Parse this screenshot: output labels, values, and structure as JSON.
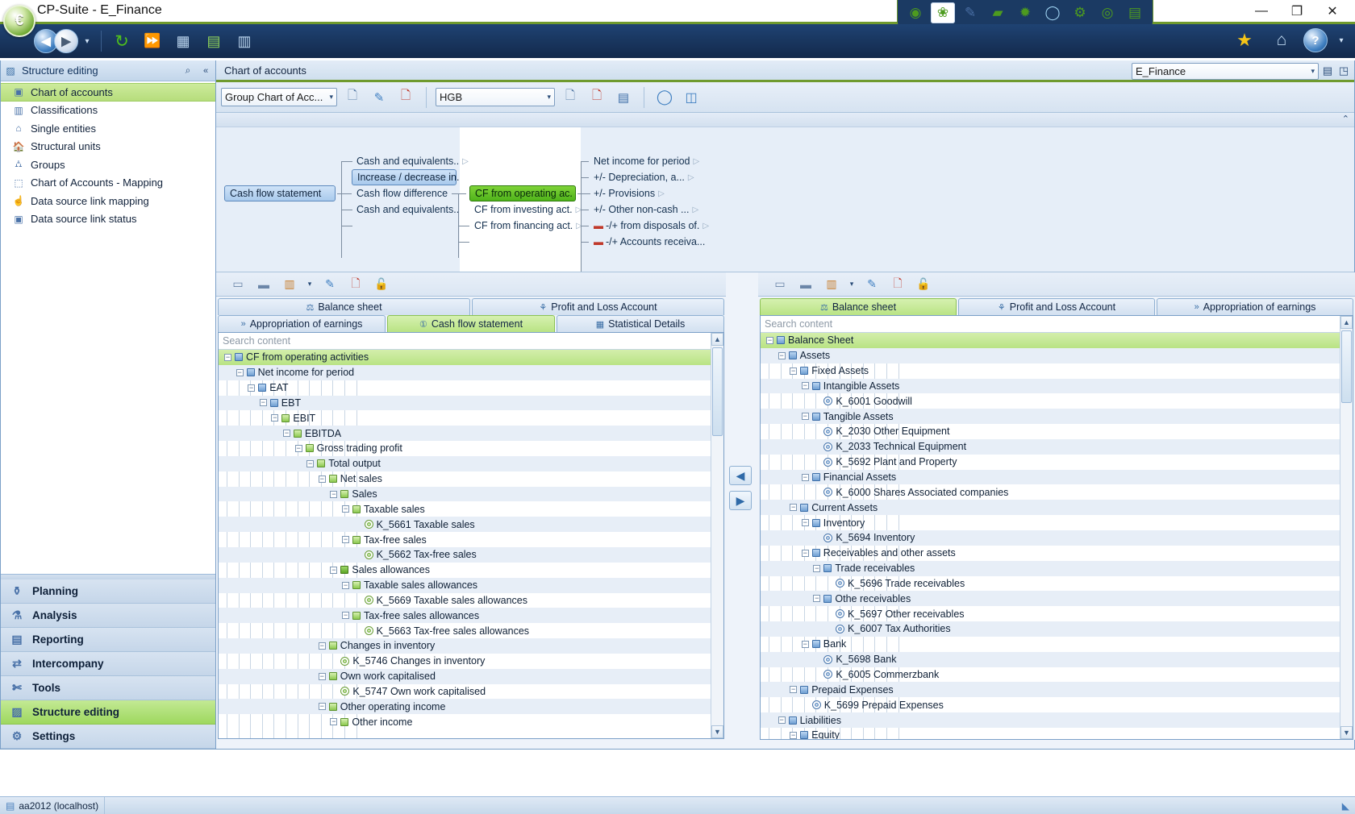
{
  "window": {
    "title": "CP-Suite - E_Finance",
    "app_icon": "euro-orb-icon",
    "minimize": "—",
    "maximize": "❐",
    "close": "✕"
  },
  "quick_access": [
    {
      "name": "dashboard-icon",
      "glyph": "◉"
    },
    {
      "name": "structure-icon",
      "glyph": "❀",
      "active": true
    },
    {
      "name": "planning-icon",
      "glyph": "✎"
    },
    {
      "name": "cash-icon",
      "glyph": "▰"
    },
    {
      "name": "globe-icon",
      "glyph": "🌐"
    },
    {
      "name": "lifering-icon",
      "glyph": "◯"
    },
    {
      "name": "gears-icon",
      "glyph": "⚙"
    },
    {
      "name": "compass-icon",
      "glyph": "◎"
    },
    {
      "name": "user-admin-icon",
      "glyph": "▤"
    }
  ],
  "navbar": {
    "back": "◀",
    "forward": "▶",
    "history_dropdown": "▾",
    "refresh": "↻",
    "fast_forward": "⏩",
    "table_icon": "▦",
    "import_icon": "▤",
    "report_icon": "▥",
    "favorites": "★",
    "home": "⌂",
    "help": "?",
    "help_dropdown": "▾"
  },
  "left_pane": {
    "header": "Structure editing",
    "search_icon": "search-icon",
    "collapse_icon": "«",
    "items": [
      {
        "label": "Chart of accounts",
        "icon": "chart-of-accounts-icon",
        "glyph": "▣",
        "selected": true
      },
      {
        "label": "Classifications",
        "icon": "classifications-icon",
        "glyph": "▥",
        "selected": false
      },
      {
        "label": "Single entities",
        "icon": "single-entities-icon",
        "glyph": "⌂",
        "selected": false
      },
      {
        "label": "Structural units",
        "icon": "structural-units-icon",
        "glyph": "🏠",
        "selected": false
      },
      {
        "label": "Groups",
        "icon": "groups-icon",
        "glyph": "⛼",
        "selected": false
      },
      {
        "label": "Chart of Accounts - Mapping",
        "icon": "mapping-icon",
        "glyph": "⬚",
        "selected": false
      },
      {
        "label": "Data source link mapping",
        "icon": "link-mapping-icon",
        "glyph": "☝",
        "selected": false
      },
      {
        "label": "Data source link status",
        "icon": "link-status-icon",
        "glyph": "▣",
        "selected": false
      }
    ],
    "modules": [
      {
        "label": "Planning",
        "icon": "watering-can-icon",
        "glyph": "⚱",
        "active": false
      },
      {
        "label": "Analysis",
        "icon": "flask-icon",
        "glyph": "⚗",
        "active": false
      },
      {
        "label": "Reporting",
        "icon": "document-icon",
        "glyph": "▤",
        "active": false
      },
      {
        "label": "Intercompany",
        "icon": "intercompany-icon",
        "glyph": "⇄",
        "active": false
      },
      {
        "label": "Tools",
        "icon": "tools-icon",
        "glyph": "✄",
        "active": false
      },
      {
        "label": "Structure editing",
        "icon": "structure-editing-icon",
        "glyph": "▨",
        "active": true
      },
      {
        "label": "Settings",
        "icon": "settings-icon",
        "glyph": "⚙",
        "active": false
      }
    ]
  },
  "document": {
    "tab_label": "Chart of accounts",
    "context_value": "E_Finance",
    "context_arrow": "▾",
    "view_icon": "▤",
    "detach_icon": "◳"
  },
  "toolbar": {
    "chart_combo_value": "Group Chart of Acc...",
    "chart_combo_arrow": "▾",
    "new_chart_icon": "▯",
    "edit_chart_icon": "✎",
    "delete_chart_icon": "▯",
    "standard_combo_value": "HGB",
    "standard_combo_arrow": "▾",
    "new_standard_icon": "▯",
    "delete_standard_icon": "▯",
    "save_icon": "💾",
    "refresh_icon": "◯",
    "compare_icon": "◫"
  },
  "graph": {
    "collapse_arrow": "⌃",
    "nodes": {
      "root": "Cash flow statement",
      "level1": [
        {
          "label": "Cash and equivalents..",
          "expandable": true,
          "style": "plain"
        },
        {
          "label": "Increase / decrease in.",
          "expandable": false,
          "style": "blue"
        },
        {
          "label": "Cash flow difference",
          "expandable": false,
          "style": "plain"
        },
        {
          "label": "Cash and equivalents..",
          "expandable": false,
          "style": "plain"
        }
      ],
      "level2": [
        {
          "label": "CF from operating ac.",
          "expandable": false,
          "style": "green"
        },
        {
          "label": "CF from investing act.",
          "expandable": true,
          "style": "plain"
        },
        {
          "label": "CF from financing act.",
          "expandable": true,
          "style": "plain"
        }
      ],
      "level3": [
        {
          "label": "Net income for period",
          "expandable": true,
          "sign": ""
        },
        {
          "label": "+/- Depreciation, a...",
          "expandable": true,
          "sign": ""
        },
        {
          "label": "+/- Provisions",
          "expandable": true,
          "sign": ""
        },
        {
          "label": "+/- Other non-cash ...",
          "expandable": true,
          "sign": ""
        },
        {
          "label": "-/+ from disposals of.",
          "expandable": true,
          "sign": "minus"
        },
        {
          "label": "-/+ Accounts receiva...",
          "expandable": false,
          "sign": "minus"
        }
      ]
    }
  },
  "left_tree_panel": {
    "toolbar": [
      {
        "name": "new-node-icon",
        "glyph": "▭"
      },
      {
        "name": "new-sibling-icon",
        "glyph": "▬"
      },
      {
        "name": "new-position-icon",
        "glyph": "▥"
      },
      {
        "name": "new-position-dropdown",
        "glyph": "▾"
      },
      {
        "name": "edit-icon",
        "glyph": "✎"
      },
      {
        "name": "delete-icon",
        "glyph": "▯"
      },
      {
        "name": "unlock-icon",
        "glyph": "🔓"
      }
    ],
    "tabs_row1": [
      {
        "label": "Balance sheet",
        "icon": "balance-scale-icon",
        "glyph": "⚖",
        "active": false
      },
      {
        "label": "Profit and Loss Account",
        "icon": "pl-icon",
        "glyph": "⚘",
        "active": false
      }
    ],
    "tabs_row2": [
      {
        "label": "Appropriation of earnings",
        "icon": "appropriation-icon",
        "glyph": "»",
        "active": false
      },
      {
        "label": "Cash flow statement",
        "icon": "cashflow-icon",
        "glyph": "①",
        "active": true
      },
      {
        "label": "Statistical Details",
        "icon": "statistics-icon",
        "glyph": "▦",
        "active": false
      }
    ],
    "search_placeholder": "Search content",
    "search_value": "",
    "rows": [
      {
        "depth": 0,
        "label": "CF from operating activities",
        "marker": "blue-square",
        "expander": "minus",
        "selected": true
      },
      {
        "depth": 1,
        "label": "Net income for period",
        "marker": "blue-square",
        "expander": "minus"
      },
      {
        "depth": 2,
        "label": "EAT",
        "marker": "blue-square",
        "expander": "minus"
      },
      {
        "depth": 3,
        "label": "EBT",
        "marker": "blue-square",
        "expander": "minus"
      },
      {
        "depth": 4,
        "label": "EBIT",
        "marker": "green-square",
        "expander": "minus"
      },
      {
        "depth": 5,
        "label": "EBITDA",
        "marker": "green-square",
        "expander": "minus"
      },
      {
        "depth": 6,
        "label": "Gross trading profit",
        "marker": "green-square",
        "expander": "minus"
      },
      {
        "depth": 7,
        "label": "Total output",
        "marker": "green-square",
        "expander": "minus"
      },
      {
        "depth": 8,
        "label": "Net sales",
        "marker": "green-square",
        "expander": "minus"
      },
      {
        "depth": 9,
        "label": "Sales",
        "marker": "green-square",
        "expander": "minus"
      },
      {
        "depth": 10,
        "label": "Taxable sales",
        "marker": "green-square",
        "expander": "minus"
      },
      {
        "depth": 11,
        "label": "K_5661 Taxable sales",
        "marker": "green-dot",
        "expander": "none"
      },
      {
        "depth": 10,
        "label": "Tax-free sales",
        "marker": "green-square",
        "expander": "minus"
      },
      {
        "depth": 11,
        "label": "K_5662 Tax-free sales",
        "marker": "green-dot",
        "expander": "none"
      },
      {
        "depth": 9,
        "label": "Sales allowances",
        "marker": "green-square-filled",
        "expander": "minus"
      },
      {
        "depth": 10,
        "label": "Taxable sales allowances",
        "marker": "green-square",
        "expander": "minus"
      },
      {
        "depth": 11,
        "label": "K_5669 Taxable sales allowances",
        "marker": "green-dot",
        "expander": "none"
      },
      {
        "depth": 10,
        "label": "Tax-free sales allowances",
        "marker": "green-square",
        "expander": "minus"
      },
      {
        "depth": 11,
        "label": "K_5663 Tax-free sales allowances",
        "marker": "green-dot",
        "expander": "none"
      },
      {
        "depth": 8,
        "label": "Changes in inventory",
        "marker": "green-square",
        "expander": "minus"
      },
      {
        "depth": 9,
        "label": "K_5746 Changes in inventory",
        "marker": "green-dot",
        "expander": "none"
      },
      {
        "depth": 8,
        "label": "Own work capitalised",
        "marker": "green-square",
        "expander": "minus"
      },
      {
        "depth": 9,
        "label": "K_5747 Own work capitalised",
        "marker": "green-dot",
        "expander": "none"
      },
      {
        "depth": 8,
        "label": "Other operating income",
        "marker": "green-square",
        "expander": "minus"
      },
      {
        "depth": 9,
        "label": "Other income",
        "marker": "green-square",
        "expander": "minus"
      }
    ],
    "scroll_up": "▲",
    "scroll_down": "▼"
  },
  "right_tree_panel": {
    "toolbar": [
      {
        "name": "new-node-icon",
        "glyph": "▭"
      },
      {
        "name": "new-sibling-icon",
        "glyph": "▬"
      },
      {
        "name": "new-position-icon",
        "glyph": "▥"
      },
      {
        "name": "new-position-dropdown",
        "glyph": "▾"
      },
      {
        "name": "edit-icon",
        "glyph": "✎"
      },
      {
        "name": "delete-icon",
        "glyph": "▯"
      },
      {
        "name": "unlock-icon",
        "glyph": "🔓"
      }
    ],
    "tabs": [
      {
        "label": "Balance sheet",
        "icon": "balance-scale-icon",
        "glyph": "⚖",
        "active": true
      },
      {
        "label": "Profit and Loss Account",
        "icon": "pl-icon",
        "glyph": "⚘",
        "active": false
      },
      {
        "label": "Appropriation of earnings",
        "icon": "appropriation-icon",
        "glyph": "»",
        "active": false
      }
    ],
    "search_placeholder": "Search content",
    "search_value": "",
    "rows": [
      {
        "depth": 0,
        "label": "Balance Sheet",
        "marker": "blue-square",
        "expander": "minus",
        "selected": true
      },
      {
        "depth": 1,
        "label": "Assets",
        "marker": "blue-square",
        "expander": "minus"
      },
      {
        "depth": 2,
        "label": "Fixed Assets",
        "marker": "blue-square",
        "expander": "minus"
      },
      {
        "depth": 3,
        "label": "Intangible Assets",
        "marker": "blue-square",
        "expander": "minus"
      },
      {
        "depth": 4,
        "label": "K_6001 Goodwill",
        "marker": "blue-dot",
        "expander": "none"
      },
      {
        "depth": 3,
        "label": "Tangible Assets",
        "marker": "blue-square",
        "expander": "minus"
      },
      {
        "depth": 4,
        "label": "K_2030 Other Equipment",
        "marker": "blue-dot",
        "expander": "none"
      },
      {
        "depth": 4,
        "label": "K_2033 Technical Equipment",
        "marker": "blue-dot",
        "expander": "none"
      },
      {
        "depth": 4,
        "label": "K_5692 Plant and Property",
        "marker": "blue-dot",
        "expander": "none"
      },
      {
        "depth": 3,
        "label": "Financial Assets",
        "marker": "blue-square",
        "expander": "minus"
      },
      {
        "depth": 4,
        "label": "K_6000 Shares Associated companies",
        "marker": "blue-dot",
        "expander": "none"
      },
      {
        "depth": 2,
        "label": "Current Assets",
        "marker": "blue-square",
        "expander": "minus"
      },
      {
        "depth": 3,
        "label": "Inventory",
        "marker": "blue-square",
        "expander": "minus"
      },
      {
        "depth": 4,
        "label": "K_5694 Inventory",
        "marker": "blue-dot",
        "expander": "none"
      },
      {
        "depth": 3,
        "label": "Receivables and other assets",
        "marker": "blue-square",
        "expander": "minus"
      },
      {
        "depth": 4,
        "label": "Trade receivables",
        "marker": "blue-square",
        "expander": "minus"
      },
      {
        "depth": 5,
        "label": "K_5696 Trade receivables",
        "marker": "blue-dot",
        "expander": "none"
      },
      {
        "depth": 4,
        "label": "Othe receivables",
        "marker": "blue-square",
        "expander": "minus"
      },
      {
        "depth": 5,
        "label": "K_5697 Other receivables",
        "marker": "blue-dot",
        "expander": "none"
      },
      {
        "depth": 5,
        "label": "K_6007 Tax Authorities",
        "marker": "blue-dot",
        "expander": "none"
      },
      {
        "depth": 3,
        "label": "Bank",
        "marker": "blue-square",
        "expander": "minus"
      },
      {
        "depth": 4,
        "label": "K_5698 Bank",
        "marker": "blue-dot",
        "expander": "none"
      },
      {
        "depth": 4,
        "label": "K_6005 Commerzbank",
        "marker": "blue-dot",
        "expander": "none"
      },
      {
        "depth": 2,
        "label": "Prepaid Expenses",
        "marker": "blue-square",
        "expander": "minus"
      },
      {
        "depth": 3,
        "label": "K_5699 Prepaid Expenses",
        "marker": "blue-dot",
        "expander": "none"
      },
      {
        "depth": 1,
        "label": "Liabilities",
        "marker": "blue-square",
        "expander": "minus"
      },
      {
        "depth": 2,
        "label": "Equity",
        "marker": "blue-square",
        "expander": "minus"
      }
    ],
    "scroll_up": "▲",
    "scroll_down": "▼"
  },
  "transfer_buttons": [
    {
      "name": "move-left-button",
      "glyph": "◀"
    },
    {
      "name": "move-right-button",
      "glyph": "▶"
    }
  ],
  "status_bar": {
    "connection": "aa2012 (localhost)",
    "connection_icon": "server-icon",
    "resize_grip": "◣"
  },
  "colors": {
    "accent_green": "#6f9a2e",
    "title_blue": "#13294b",
    "selection_green": "#b9e384",
    "node_green": "#5cb71a",
    "node_blue": "#a9caec"
  }
}
